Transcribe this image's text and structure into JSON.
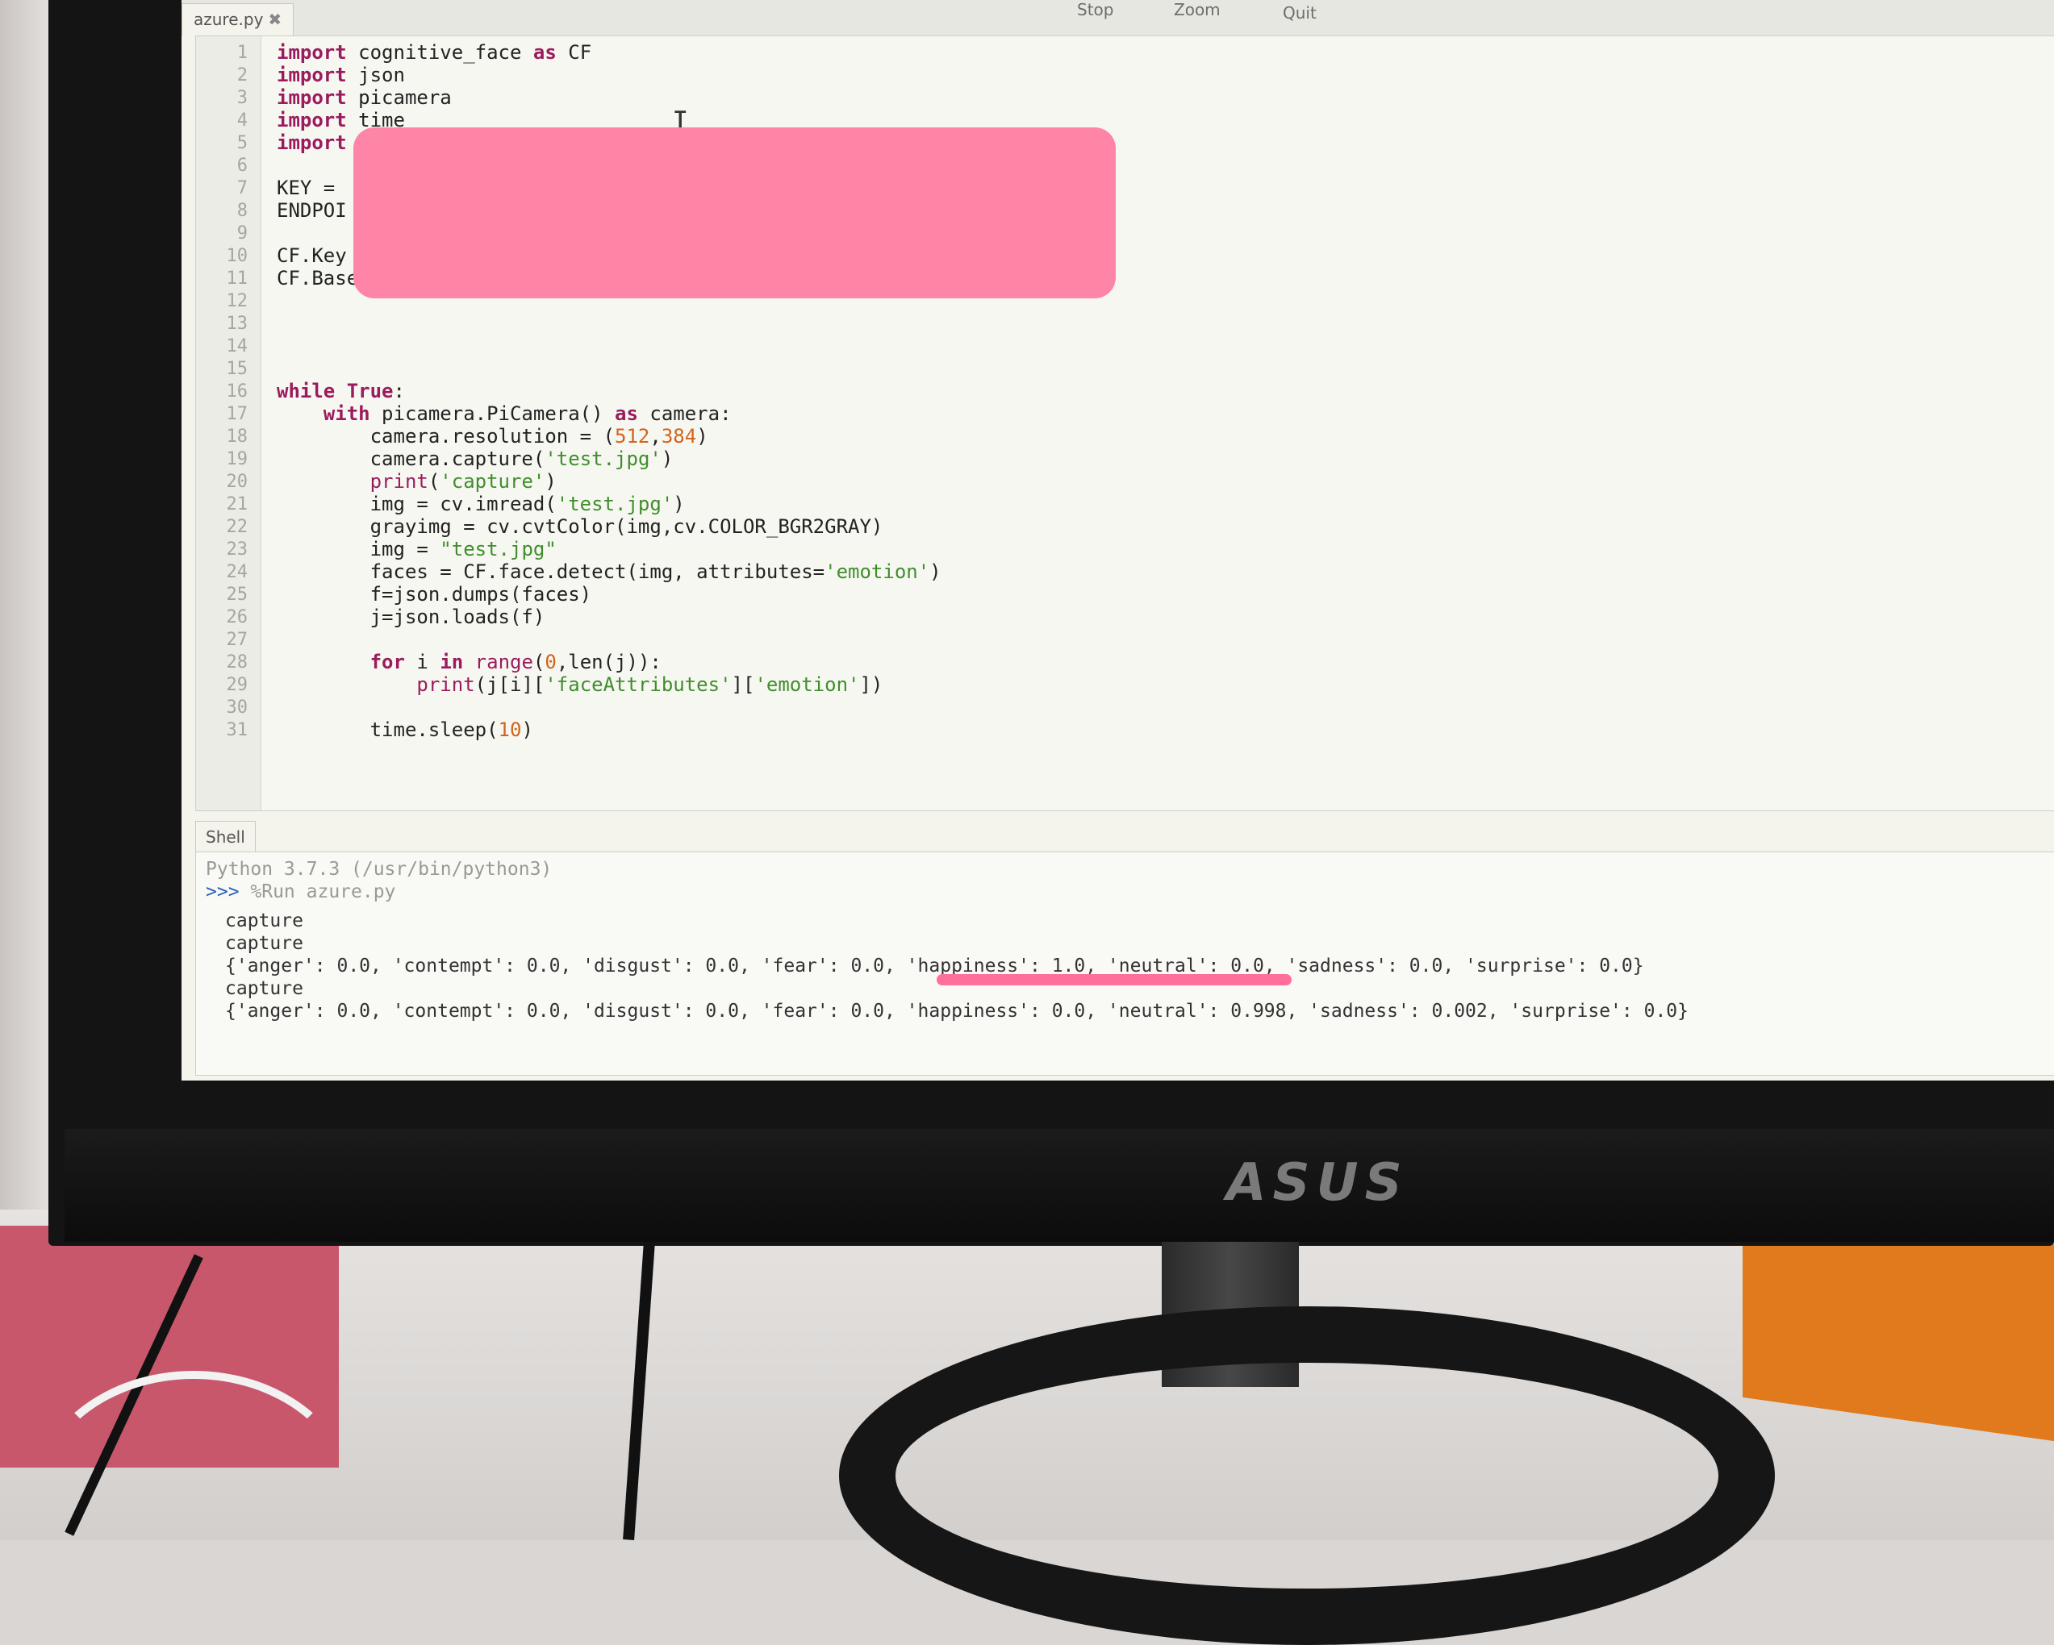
{
  "toolbar": {
    "buttons": [
      "Stop",
      "Zoom",
      "Quit"
    ]
  },
  "editor": {
    "tab_label": "azure.py",
    "tab_close": "✖",
    "line_numbers": [
      "1",
      "2",
      "3",
      "4",
      "5",
      "6",
      "7",
      "8",
      "9",
      "10",
      "11",
      "12",
      "13",
      "14",
      "15",
      "16",
      "17",
      "18",
      "19",
      "20",
      "21",
      "22",
      "23",
      "24",
      "25",
      "26",
      "27",
      "28",
      "29",
      "30",
      "31"
    ],
    "lines": {
      "l1_kw": "import",
      "l1_rest": " cognitive_face ",
      "l1_as": "as",
      "l1_tail": " CF",
      "l2_kw": "import",
      "l2_rest": " json",
      "l3_kw": "import",
      "l3_rest": " picamera",
      "l4_kw": "import",
      "l4_rest": " time",
      "l5_kw": "import",
      "l7": "KEY = ",
      "l8": "ENDPOI",
      "l10": "CF.Key",
      "l11": "CF.Base",
      "l16_kw": "while",
      "l16_true": "True",
      "l16_tail": ":",
      "l17_kw": "with",
      "l17_rest": " picamera.PiCamera() ",
      "l17_as": "as",
      "l17_tail": " camera:",
      "l18_rest": "camera.resolution = (",
      "l18_n1": "512",
      "l18_c": ",",
      "l18_n2": "384",
      "l18_tail": ")",
      "l19_rest": "camera.capture(",
      "l19_str": "'test.jpg'",
      "l19_tail": ")",
      "l20_fn": "print",
      "l20_open": "(",
      "l20_str": "'capture'",
      "l20_tail": ")",
      "l21_rest": "img = cv.imread(",
      "l21_str": "'test.jpg'",
      "l21_tail": ")",
      "l22": "grayimg = cv.cvtColor(img,cv.COLOR_BGR2GRAY)",
      "l23_rest": "img = ",
      "l23_str": "\"test.jpg\"",
      "l24_rest": "faces = CF.face.detect(img, attributes=",
      "l24_str": "'emotion'",
      "l24_tail": ")",
      "l25": "f=json.dumps(faces)",
      "l26": "j=json.loads(f)",
      "l28_kw": "for",
      "l28_mid": " i ",
      "l28_in": "in",
      "l28_fn": " range",
      "l28_open": "(",
      "l28_n": "0",
      "l28_tail": ",len(j)):",
      "l29_fn": "print",
      "l29_rest": "(j[i][",
      "l29_s1": "'faceAttributes'",
      "l29_mid": "][",
      "l29_s2": "'emotion'",
      "l29_tail": "])",
      "l31_rest": "time.sleep(",
      "l31_n": "10",
      "l31_tail": ")"
    }
  },
  "shell": {
    "tab_label": "Shell",
    "version_line": "Python 3.7.3 (/usr/bin/python3)",
    "prompt": ">>>",
    "command": " %Run azure.py",
    "output": [
      "capture",
      "capture",
      "{'anger': 0.0, 'contempt': 0.0, 'disgust': 0.0, 'fear': 0.0, 'happiness': 1.0, 'neutral': 0.0, 'sadness': 0.0, 'surprise': 0.0}",
      "capture",
      "{'anger': 0.0, 'contempt': 0.0, 'disgust': 0.0, 'fear': 0.0, 'happiness': 0.0, 'neutral': 0.998, 'sadness': 0.002, 'surprise': 0.0}"
    ]
  },
  "monitor": {
    "brand": "ASUS"
  },
  "colors": {
    "keyword": "#9b1c5e",
    "string": "#3f8e2c",
    "number": "#d2641a",
    "redaction": "#ff85a6",
    "highlight_underline": "#ff6f9c"
  }
}
